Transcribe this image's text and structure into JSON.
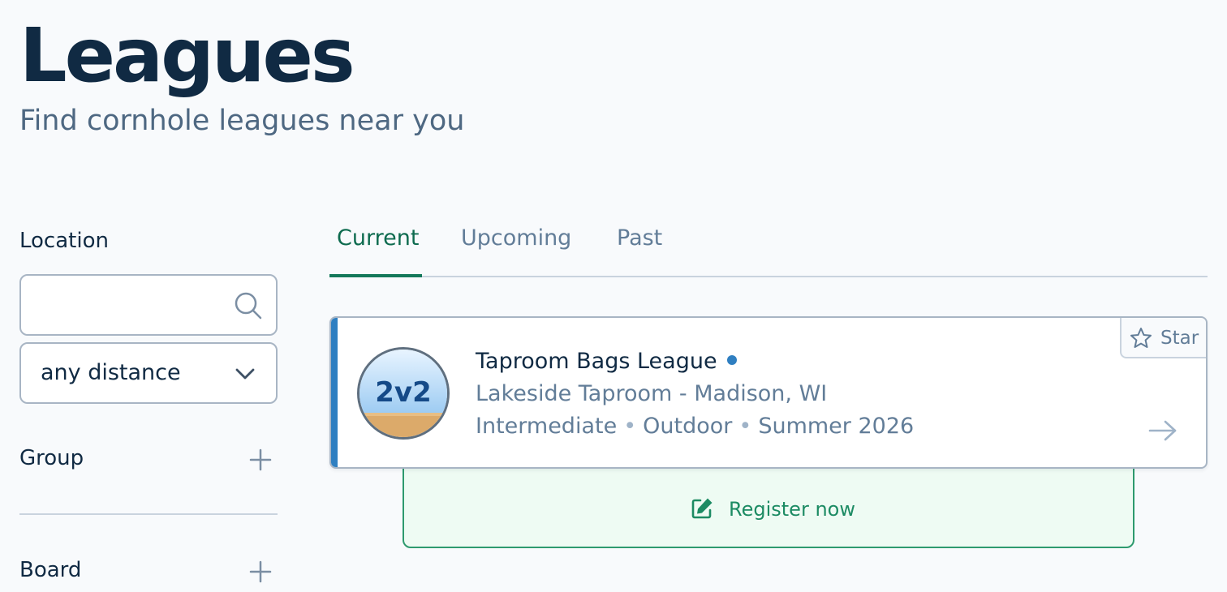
{
  "header": {
    "title": "Leagues",
    "subtitle": "Find cornhole leagues near you"
  },
  "sidebar": {
    "location_label": "Location",
    "search": {
      "value": "",
      "placeholder": "",
      "icon": "search-icon"
    },
    "distance": {
      "selected": "any distance",
      "icon": "chevron-down-icon"
    },
    "filters": [
      {
        "label": "Group",
        "icon": "plus-icon"
      },
      {
        "label": "Board",
        "icon": "plus-icon"
      }
    ]
  },
  "tabs": [
    {
      "label": "Current",
      "active": true
    },
    {
      "label": "Upcoming",
      "active": false
    },
    {
      "label": "Past",
      "active": false
    }
  ],
  "leagues": [
    {
      "name": "Taproom Bags League",
      "venue": "Lakeside Taproom - Madison, WI",
      "level": "Intermediate",
      "setting": "Outdoor",
      "season": "Summer 2026",
      "avatar_text": "2v2",
      "star_label": "Star",
      "register_label": "Register now"
    }
  ],
  "colors": {
    "accent_green": "#14785a",
    "accent_blue": "#2f7fc1",
    "title_navy": "#102a43",
    "muted_text": "#627d98",
    "register_bg": "#eefbf3"
  }
}
